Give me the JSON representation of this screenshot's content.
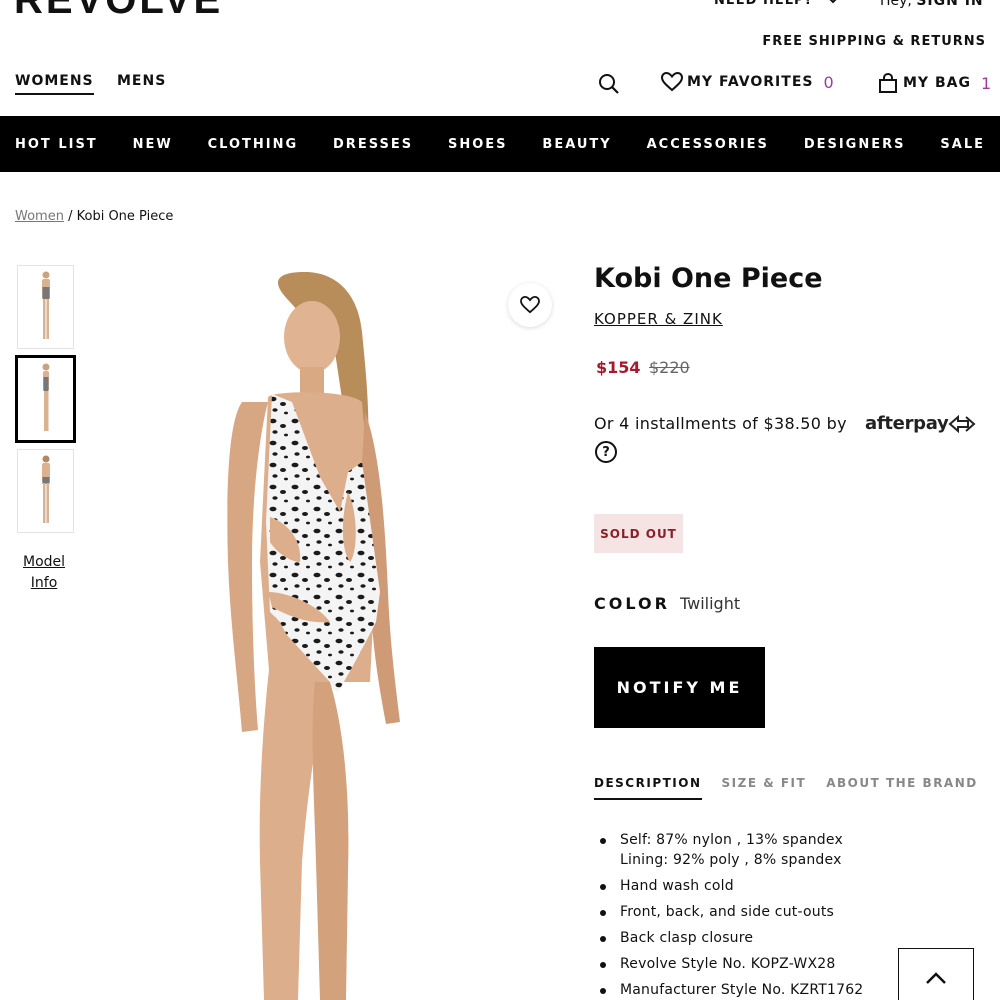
{
  "header": {
    "logo": "REVOLVE",
    "need_help": "NEED HELP?",
    "greeting": "Hey,",
    "sign_in": "SIGN IN",
    "free_shipping": "FREE SHIPPING & RETURNS",
    "genders": [
      "WOMENS",
      "MENS"
    ],
    "favorites_label": "MY FAVORITES",
    "favorites_count": "0",
    "bag_label": "MY BAG",
    "bag_count": "1",
    "accent_color": "#a03aa3"
  },
  "nav": {
    "items": [
      "HOT LIST",
      "NEW",
      "CLOTHING",
      "DRESSES",
      "SHOES",
      "BEAUTY",
      "ACCESSORIES",
      "DESIGNERS",
      "SALE"
    ]
  },
  "breadcrumb": {
    "parent": "Women",
    "separator": "/",
    "current": "Kobi One Piece"
  },
  "gallery": {
    "thumbnail_count": 3,
    "active_thumbnail": 2,
    "model_info_line1": "Model",
    "model_info_line2": "Info"
  },
  "product": {
    "title": "Kobi One Piece",
    "brand": "KOPPER & ZINK",
    "sale_price": "$154",
    "original_price": "$220",
    "installments_text": "Or 4 installments of $38.50 by",
    "afterpay_logo": "afterpay",
    "help_mark": "?",
    "status": "SOLD OUT",
    "color_label": "COLOR",
    "color_value": "Twilight",
    "notify_button": "NOTIFY ME",
    "sale_color": "#a6192e"
  },
  "tabs": [
    "DESCRIPTION",
    "SIZE & FIT",
    "ABOUT THE BRAND"
  ],
  "description": {
    "fabric_self": "Self: 87% nylon , 13% spandex",
    "fabric_lining": "Lining: 92% poly , 8% spandex",
    "care": "Hand wash cold",
    "cutouts": "Front, back, and side cut-outs",
    "closure": "Back clasp closure",
    "style_no": "Revolve Style No. KOPZ-WX28",
    "mfr_style_no": "Manufacturer Style No. KZRT1762"
  }
}
